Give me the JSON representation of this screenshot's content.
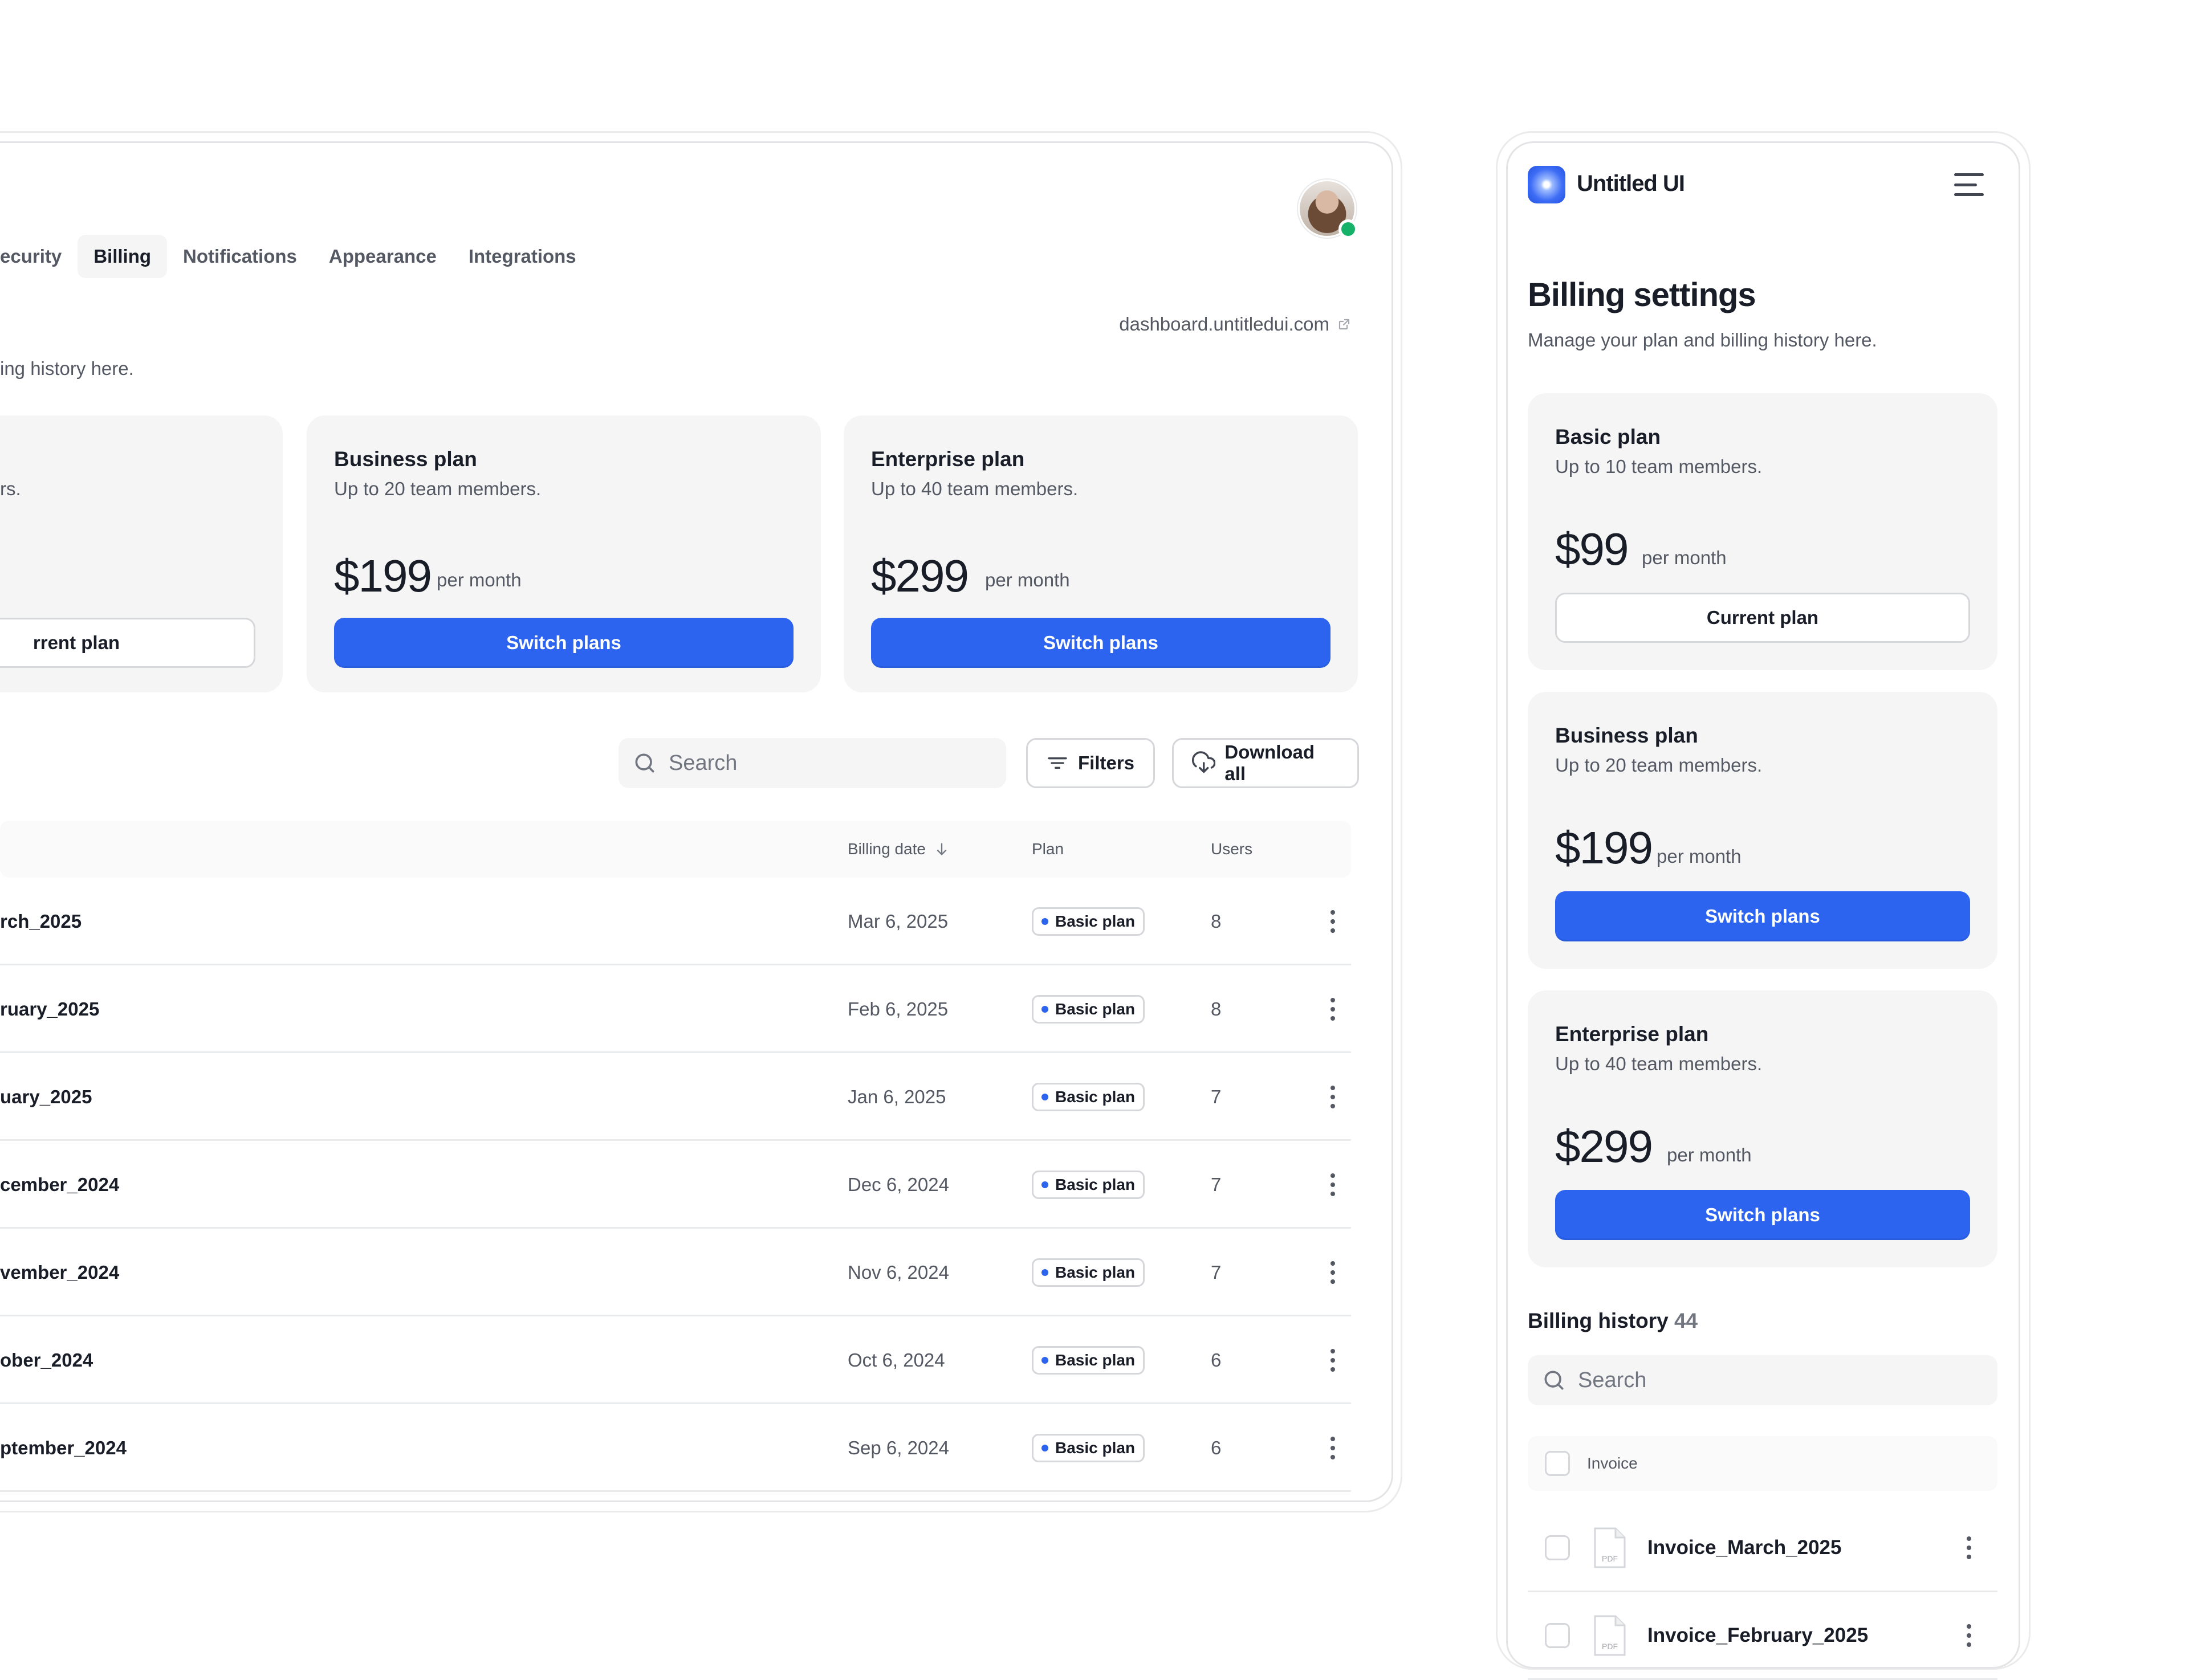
{
  "colors": {
    "accent": "#2c64f0",
    "online": "#17b26a",
    "card_bg": "#f5f5f5"
  },
  "desktop": {
    "tabs": [
      "ecurity",
      "Billing",
      "Notifications",
      "Appearance",
      "Integrations"
    ],
    "subtitle": "ing history here.",
    "dashboard_link": "dashboard.untitledui.com",
    "plans": [
      {
        "name": "",
        "desc": "rs.",
        "price": "",
        "period": "",
        "button": "rrent plan"
      },
      {
        "name": "Business plan",
        "desc": "Up to 20 team members.",
        "price": "$199",
        "period": "per month",
        "button": "Switch plans"
      },
      {
        "name": "Enterprise plan",
        "desc": "Up to 40 team members.",
        "price": "$299",
        "period": "per month",
        "button": "Switch plans"
      }
    ],
    "search_placeholder": "Search",
    "filters_label": "Filters",
    "download_label": "Download all",
    "columns": {
      "billing_date": "Billing date",
      "plan": "Plan",
      "users": "Users"
    },
    "rows": [
      {
        "invoice": "rch_2025",
        "date": "Mar 6, 2025",
        "plan": "Basic plan",
        "users": "8"
      },
      {
        "invoice": "ruary_2025",
        "date": "Feb 6, 2025",
        "plan": "Basic plan",
        "users": "8"
      },
      {
        "invoice": "uary_2025",
        "date": "Jan 6, 2025",
        "plan": "Basic plan",
        "users": "7"
      },
      {
        "invoice": "cember_2024",
        "date": "Dec 6, 2024",
        "plan": "Basic plan",
        "users": "7"
      },
      {
        "invoice": "vember_2024",
        "date": "Nov 6, 2024",
        "plan": "Basic plan",
        "users": "7"
      },
      {
        "invoice": "ober_2024",
        "date": "Oct 6, 2024",
        "plan": "Basic plan",
        "users": "6"
      },
      {
        "invoice": "ptember_2024",
        "date": "Sep 6, 2024",
        "plan": "Basic plan",
        "users": "6"
      }
    ]
  },
  "mobile": {
    "brand": "Untitled UI",
    "title": "Billing settings",
    "subtitle": "Manage your plan and billing history here.",
    "plans": [
      {
        "name": "Basic plan",
        "desc": "Up to 10 team members.",
        "price": "$99",
        "period": "per month",
        "button": "Current plan"
      },
      {
        "name": "Business plan",
        "desc": "Up to 20 team members.",
        "price": "$199",
        "period": "per month",
        "button": "Switch plans"
      },
      {
        "name": "Enterprise plan",
        "desc": "Up to 40 team members.",
        "price": "$299",
        "period": "per month",
        "button": "Switch plans"
      }
    ],
    "history_label": "Billing history",
    "history_count": "44",
    "search_placeholder": "Search",
    "invoice_header": "Invoice",
    "file_type": "PDF",
    "invoices": [
      "Invoice_March_2025",
      "Invoice_February_2025"
    ]
  }
}
